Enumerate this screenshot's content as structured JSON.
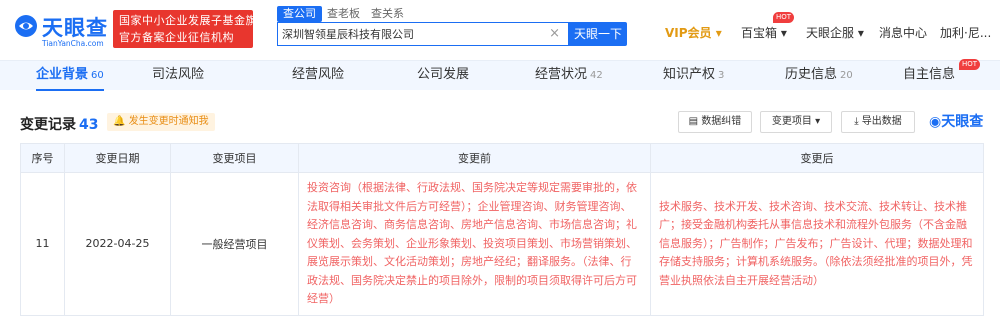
{
  "header": {
    "logo_name": "天眼查",
    "logo_domain": "TianYanCha.com",
    "gov_badge": [
      "国家中小企业发展子基金旗下",
      "官方备案企业征信机构"
    ],
    "search_tabs": [
      "查公司",
      "查老板",
      "查关系"
    ],
    "search_value": "深圳智领星辰科技有限公司",
    "search_button": "天眼一下",
    "nav": {
      "vip": "VIP会员 ▾",
      "baibaoxiang": "百宝箱 ▾",
      "enterprise": "天眼企服 ▾",
      "messages": "消息中心",
      "user": "加利·尼..."
    },
    "hot_label": "HOT",
    "colors": {
      "brand": "#1b6ef3",
      "gov_red": "#e8362e",
      "vip_gold": "#e29a13",
      "hot": "#f03e3e"
    }
  },
  "tabs": [
    {
      "label": "企业背景",
      "count": "60",
      "active": true
    },
    {
      "label": "司法风险",
      "count": ""
    },
    {
      "label": "经营风险",
      "count": ""
    },
    {
      "label": "公司发展",
      "count": ""
    },
    {
      "label": "经营状况",
      "count": "42"
    },
    {
      "label": "知识产权",
      "count": "3"
    },
    {
      "label": "历史信息",
      "count": "20"
    },
    {
      "label": "自主信息",
      "count": ""
    }
  ],
  "section": {
    "title": "变更记录",
    "count": "43",
    "notify": "发生变更时通知我",
    "tools": [
      "数据纠错",
      "变更项目 ▾",
      "导出数据"
    ],
    "brand": "天眼查"
  },
  "table": {
    "headers": [
      "序号",
      "变更日期",
      "变更项目",
      "变更前",
      "变更后"
    ],
    "row": {
      "index": "11",
      "date": "2022-04-25",
      "item": "一般经营项目",
      "before": "投资咨询（根据法律、行政法规、国务院决定等规定需要审批的，依法取得相关审批文件后方可经营）；企业管理咨询、财务管理咨询、经济信息咨询、商务信息咨询、房地产信息咨询、市场信息咨询；礼仪策划、会务策划、企业形象策划、投资项目策划、市场营销策划、展览展示策划、文化活动策划；房地产经纪；翻译服务。（法律、行政法规、国务院决定禁止的项目除外，限制的项目须取得许可后方可经营）",
      "after": "技术服务、技术开发、技术咨询、技术交流、技术转让、技术推广；接受金融机构委托从事信息技术和流程外包服务（不含金融信息服务）；广告制作；广告发布；广告设计、代理；数据处理和存储支持服务；计算机系统服务。（除依法须经批准的项目外，凭营业执照依法自主开展经营活动）"
    }
  }
}
